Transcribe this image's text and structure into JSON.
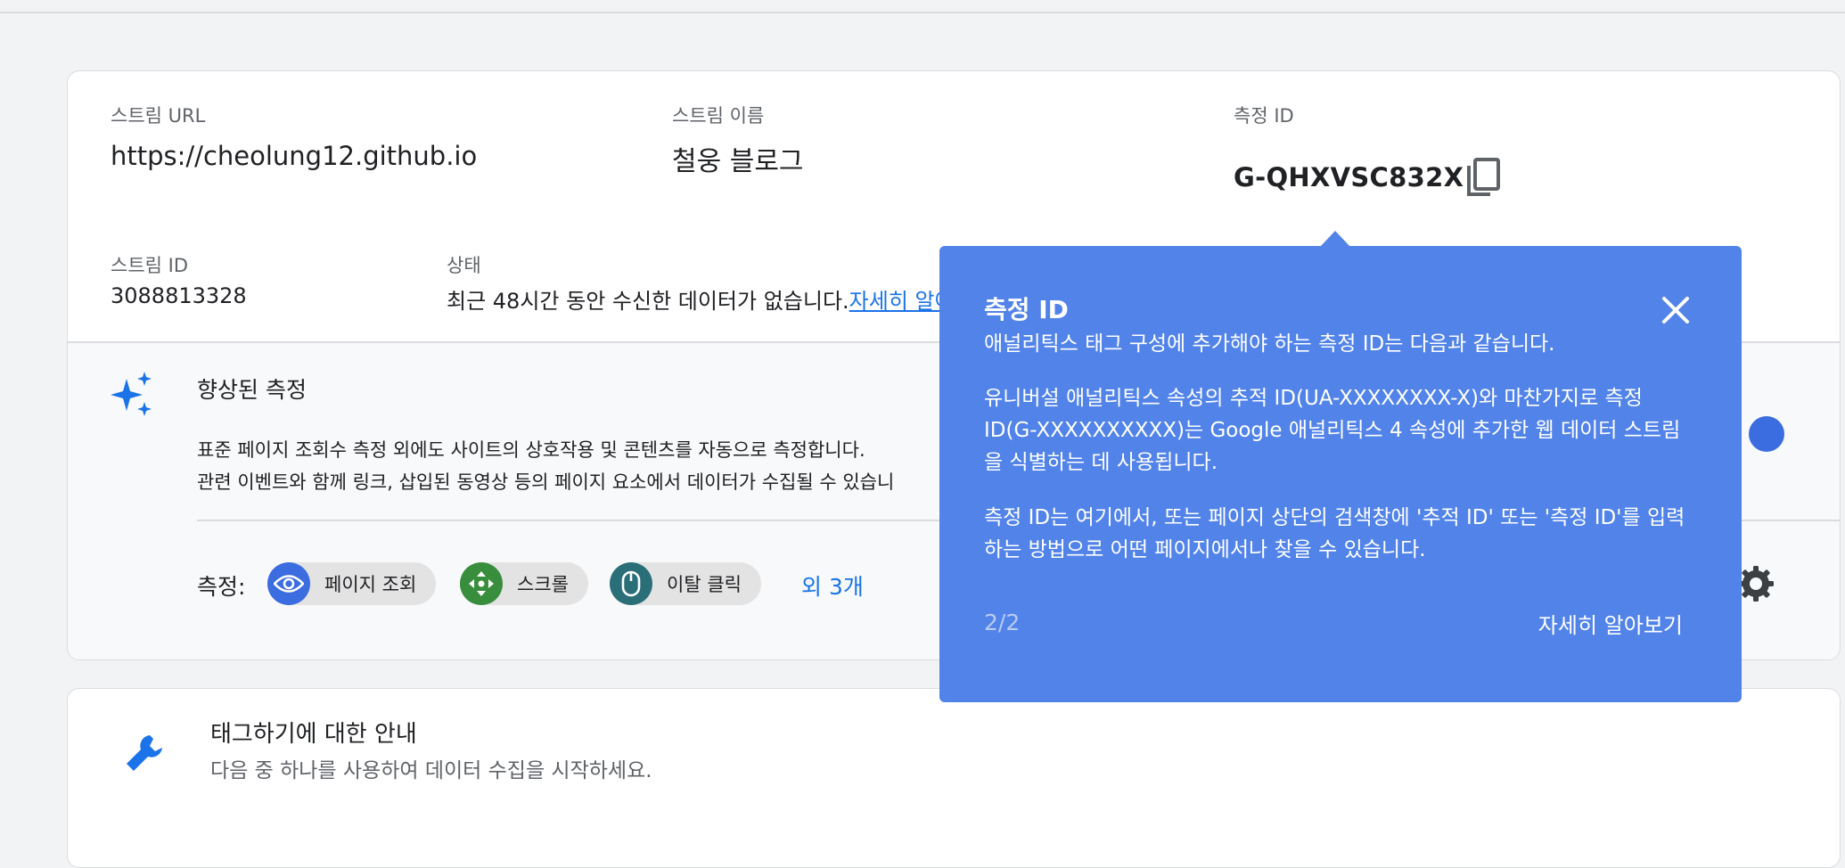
{
  "stream": {
    "url_label": "스트림 URL",
    "url_value": "https://cheolung12.github.io",
    "name_label": "스트림 이름",
    "name_value": "철웅 블로그",
    "measurement_label": "측정 ID",
    "measurement_value": "G-QHXVSC832X",
    "id_label": "스트림 ID",
    "id_value": "3088813328",
    "status_label": "상태",
    "status_text": "최근 48시간 동안 수신한 데이터가 없습니다.",
    "status_link": "자세히 알아"
  },
  "enhanced": {
    "title": "향상된 측정",
    "desc1": "표준 페이지 조회수 측정 외에도 사이트의 상호작용 및 콘텐츠를 자동으로 측정합니다.",
    "desc2": "관련 이벤트와 함께 링크, 삽입된 동영상 등의 페이지 요소에서 데이터가 수집될 수 있습니",
    "measure_label": "측정:",
    "chips": [
      {
        "label": "페이지 조회",
        "icon": "eye-icon",
        "color": "#3b6de0"
      },
      {
        "label": "스크롤",
        "icon": "scroll-arrows-icon",
        "color": "#388e3c"
      },
      {
        "label": "이탈 클릭",
        "icon": "mouse-icon",
        "color": "#2a6f78"
      }
    ],
    "more_link": "외 3개"
  },
  "tagging": {
    "title": "태그하기에 대한 안내",
    "subtitle": "다음 중 하나를 사용하여 데이터 수집을 시작하세요."
  },
  "popup": {
    "title": "측정 ID",
    "line1": "애널리틱스 태그 구성에 추가해야 하는 측정 ID는 다음과 같습니다.",
    "para2": "유니버설 애널리틱스 속성의 추적 ID(UA-XXXXXXXX-X)와 마찬가지로 측정 ID(G-XXXXXXXXXX)는 Google 애널리틱스 4 속성에 추가한 웹 데이터 스트림을 식별하는 데 사용됩니다.",
    "para3": "측정 ID는 여기에서, 또는 페이지 상단의 검색창에 '추적 ID' 또는 '측정 ID'를 입력하는 방법으로 어떤 페이지에서나 찾을 수 있습니다.",
    "pager": "2/2",
    "learn_more": "자세히 알아보기"
  },
  "colors": {
    "popup_bg": "#5283e9",
    "link": "#1a73e8",
    "accent_blue": "#3b6de0"
  }
}
